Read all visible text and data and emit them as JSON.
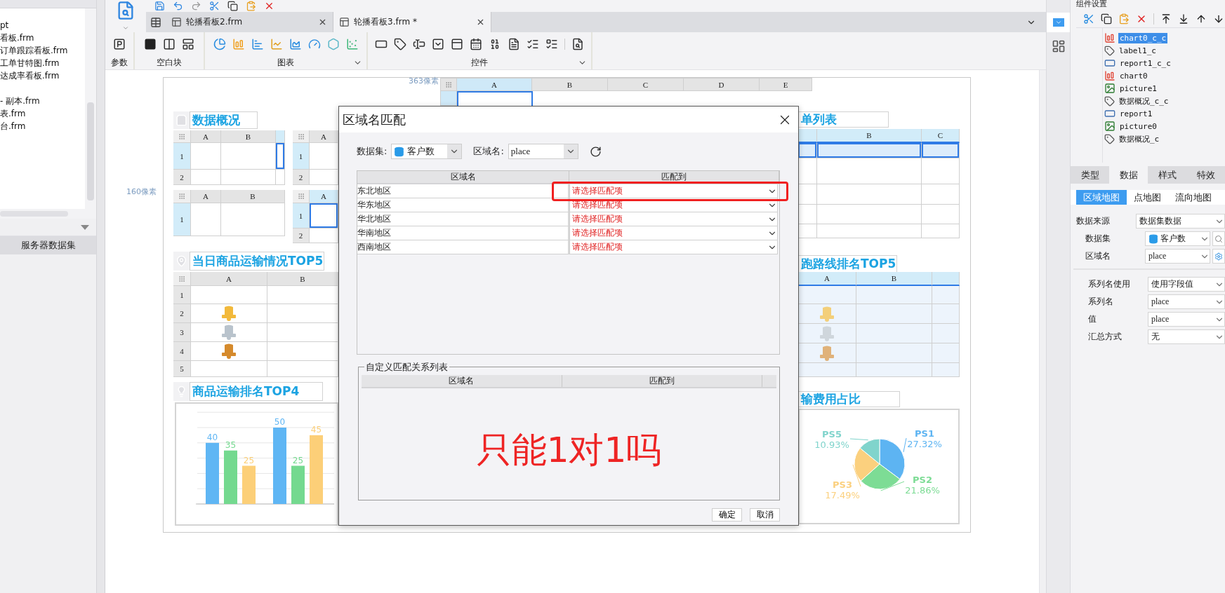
{
  "file_panel": {
    "file_groups": [
      {
        "files": [
          "pt",
          "看板.frm",
          "订单跟踪看板.frm",
          "工单甘特图.frm",
          "达成率看板.frm"
        ]
      },
      {
        "files": [
          "- 副本.frm",
          "表.frm",
          "台.frm"
        ]
      }
    ],
    "server_dataset_button": "服务器数据集"
  },
  "editor_tabs": [
    {
      "label": "轮播看板2.frm",
      "selected": false
    },
    {
      "label": "轮播看板3.frm *",
      "selected": true
    }
  ],
  "ribbon_groups": [
    {
      "kind": "parameter",
      "label": "参数"
    },
    {
      "kind": "blank",
      "label": "空白块"
    },
    {
      "kind": "chart",
      "label": "图表"
    },
    {
      "kind": "widget",
      "label": "控件"
    }
  ],
  "canvas": {
    "width_hint": "363像素",
    "height_hint": "160像素",
    "column_headers": [
      {
        "label": "A",
        "selected": true
      },
      {
        "label": "B",
        "selected": false
      },
      {
        "label": "C",
        "selected": false
      },
      {
        "label": "D",
        "selected": false
      },
      {
        "label": "E",
        "selected": false
      }
    ],
    "titles": [
      {
        "text": "数据概况"
      },
      {
        "text": "当日商品运输情况TOP5"
      },
      {
        "text": "商品运输排名TOP4"
      },
      {
        "text": "单列表"
      },
      {
        "text": "跑路线排名TOP5"
      },
      {
        "text": "输费用占比"
      }
    ],
    "grids": [
      {
        "tinted": false,
        "columns": [
          {
            "label": "A",
            "selected": false
          },
          {
            "label": "B",
            "selected": false
          },
          {
            "selected": true
          }
        ],
        "rows": [
          {
            "label": "1",
            "selected": true
          },
          {
            "label": "2",
            "selected": false
          }
        ]
      },
      {
        "tinted": false,
        "columns": [
          {
            "label": "A",
            "selected": false
          }
        ],
        "rows": [
          {
            "label": "1",
            "selected": true
          },
          {
            "label": "2",
            "selected": false
          }
        ]
      },
      {
        "tinted": false,
        "columns": [
          {
            "label": "A",
            "selected": false
          },
          {
            "label": "B",
            "selected": false
          }
        ],
        "rows": [
          {
            "label": "1",
            "selected": true
          }
        ]
      },
      {
        "tinted": false,
        "columns": [
          {
            "label": "A",
            "selected": true
          }
        ],
        "rows": [
          {
            "label": "1",
            "selected": true
          },
          {
            "label": "2",
            "selected": false
          }
        ]
      },
      {
        "tinted": false,
        "columns": [
          {
            "label": "A",
            "selected": false
          },
          {
            "label": "B",
            "selected": false
          }
        ],
        "rows": [
          {
            "label": "1",
            "selected": false
          },
          {
            "label": "2",
            "selected": false,
            "color": "#f2b93b"
          },
          {
            "label": "3",
            "selected": false,
            "color": "#b9c3cc"
          },
          {
            "label": "4",
            "selected": false,
            "color": "#d58a2c"
          },
          {
            "label": "5",
            "selected": false
          }
        ]
      },
      {
        "tinted": false,
        "columns": [
          {
            "selected": true
          },
          {
            "label": "B",
            "selected": true
          },
          {
            "label": "C",
            "selected": true
          }
        ],
        "rows": [
          {
            "selected": true
          },
          {
            "selected": false
          },
          {
            "selected": false
          },
          {
            "selected": false
          },
          {
            "selected": false
          }
        ]
      },
      {
        "tinted": true,
        "columns": [
          {
            "label": "A",
            "selected": true
          },
          {
            "label": "B",
            "selected": true
          },
          {
            "selected": true
          }
        ],
        "rows": [
          {
            "selected": false
          },
          {
            "selected": false,
            "color": "#f3cf7a"
          },
          {
            "selected": false,
            "color": "#cfd6dc"
          },
          {
            "selected": false,
            "color": "#e0b27a"
          },
          {
            "selected": false
          }
        ]
      }
    ],
    "bar_chart": {
      "chart_data": {
        "type": "bar",
        "data_labels": true,
        "series": [
          {
            "color": "#5fb6f4",
            "values": [
              40,
              50
            ]
          },
          {
            "color": "#74d98f",
            "values": [
              35,
              25
            ]
          },
          {
            "color": "#fccf78",
            "values": [
              25,
              45
            ]
          }
        ]
      }
    },
    "pie_chart": {
      "chart_data": {
        "type": "pie",
        "categories": [
          "PS1",
          "PS2",
          "PS3",
          "PS5"
        ],
        "values": [
          27.32,
          21.86,
          17.49,
          10.93
        ],
        "value_labels": [
          "27.32%",
          "21.86%",
          "17.49%",
          "10.93%"
        ]
      }
    }
  },
  "dialog": {
    "title": "区域名匹配",
    "dataset_label": "数据集:",
    "dataset": "客户数",
    "region_label": "区域名:",
    "region": "place",
    "match_table": {
      "columns": [
        "区域名",
        "匹配到"
      ],
      "rows": [
        {
          "region": "东北地区",
          "match": "请选择匹配项"
        },
        {
          "region": "华东地区",
          "match": "请选择匹配项"
        },
        {
          "region": "华北地区",
          "match": "请选择匹配项"
        },
        {
          "region": "华南地区",
          "match": "请选择匹配项"
        },
        {
          "region": "西南地区",
          "match": "请选择匹配项"
        }
      ]
    },
    "custom_group": {
      "title": "自定义匹配关系列表",
      "columns": [
        "区域名",
        "匹配到"
      ]
    },
    "annotation": "只能1对1吗",
    "buttons": [
      "确定",
      "取消"
    ]
  },
  "properties": {
    "title": "组件设置",
    "tree": [
      {
        "label": "chart0_c_c",
        "kind": "chart",
        "selected": true
      },
      {
        "label": "label1_c",
        "kind": "label",
        "selected": false
      },
      {
        "label": "report1_c_c",
        "kind": "report",
        "selected": false
      },
      {
        "label": "chart0",
        "kind": "chart",
        "selected": false
      },
      {
        "label": "picture1",
        "kind": "picture",
        "selected": false
      },
      {
        "label": "数据概况_c_c",
        "kind": "label",
        "selected": false
      },
      {
        "label": "report1",
        "kind": "report",
        "selected": false
      },
      {
        "label": "picture0",
        "kind": "picture",
        "selected": false
      },
      {
        "label": "数据概况_c",
        "kind": "label",
        "selected": false
      }
    ],
    "tabs": [
      {
        "label": "类型",
        "selected": false
      },
      {
        "label": "数据",
        "selected": true
      },
      {
        "label": "样式",
        "selected": false
      },
      {
        "label": "特效",
        "selected": false
      }
    ],
    "map_tabs": [
      {
        "label": "区域地图",
        "selected": true
      },
      {
        "label": "点地图",
        "selected": false
      },
      {
        "label": "流向地图",
        "selected": false
      }
    ],
    "field_groups": [
      {
        "fields": [
          {
            "kind": "source",
            "label": "数据来源",
            "value": "数据集数据"
          },
          {
            "kind": "dataset",
            "label": "数据集",
            "value": "客户数"
          },
          {
            "kind": "region",
            "label": "区域名",
            "value": "place"
          }
        ]
      },
      {
        "fields": [
          {
            "kind": "select",
            "label": "系列名使用",
            "value": "使用字段值"
          },
          {
            "kind": "select",
            "label": "系列名",
            "value": "place"
          },
          {
            "kind": "select",
            "label": "值",
            "value": "place"
          },
          {
            "kind": "select",
            "label": "汇总方式",
            "value": "无"
          }
        ]
      }
    ]
  }
}
